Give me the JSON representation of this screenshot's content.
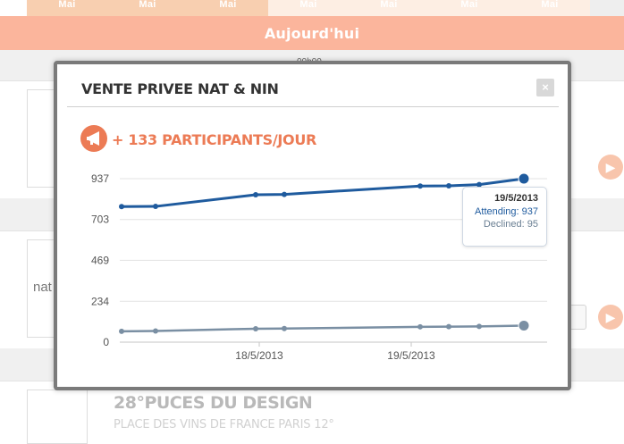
{
  "calendar": {
    "months": [
      "Mai",
      "Mai",
      "Mai",
      "Mai",
      "Mai",
      "Mai",
      "Mai"
    ],
    "today_label": "Aujourd'hui",
    "time_label": "00h00"
  },
  "background_list": {
    "thumb_brand": "nat",
    "event_title": "28°PUCES DU DESIGN",
    "event_subtitle": "PLACE DES VINS DE FRANCE PARIS 12°",
    "button_fragment": "s"
  },
  "modal": {
    "title": "VENTE PRIVEE NAT & NIN",
    "close_glyph": "×",
    "stat_label": "+ 133 PARTICIPANTS/JOUR",
    "stat_icon": "megaphone-icon",
    "accent_color": "#ec7b55"
  },
  "chart_data": {
    "type": "line",
    "x_ticks": [
      "18/5/2013",
      "19/5/2013"
    ],
    "y_ticks": [
      0,
      234,
      469,
      703,
      937
    ],
    "ylim": [
      0,
      937
    ],
    "grid": true,
    "series": [
      {
        "name": "Attending",
        "color": "#1f5b9e",
        "values": [
          777,
          778,
          845,
          847,
          895,
          896,
          903,
          937
        ]
      },
      {
        "name": "Declined",
        "color": "#7a8fa3",
        "values": [
          62,
          64,
          77,
          78,
          88,
          89,
          90,
          95
        ]
      }
    ],
    "tooltip": {
      "date": "19/5/2013",
      "attending_label": "Attending: 937",
      "declined_label": "Declined: 95"
    }
  }
}
